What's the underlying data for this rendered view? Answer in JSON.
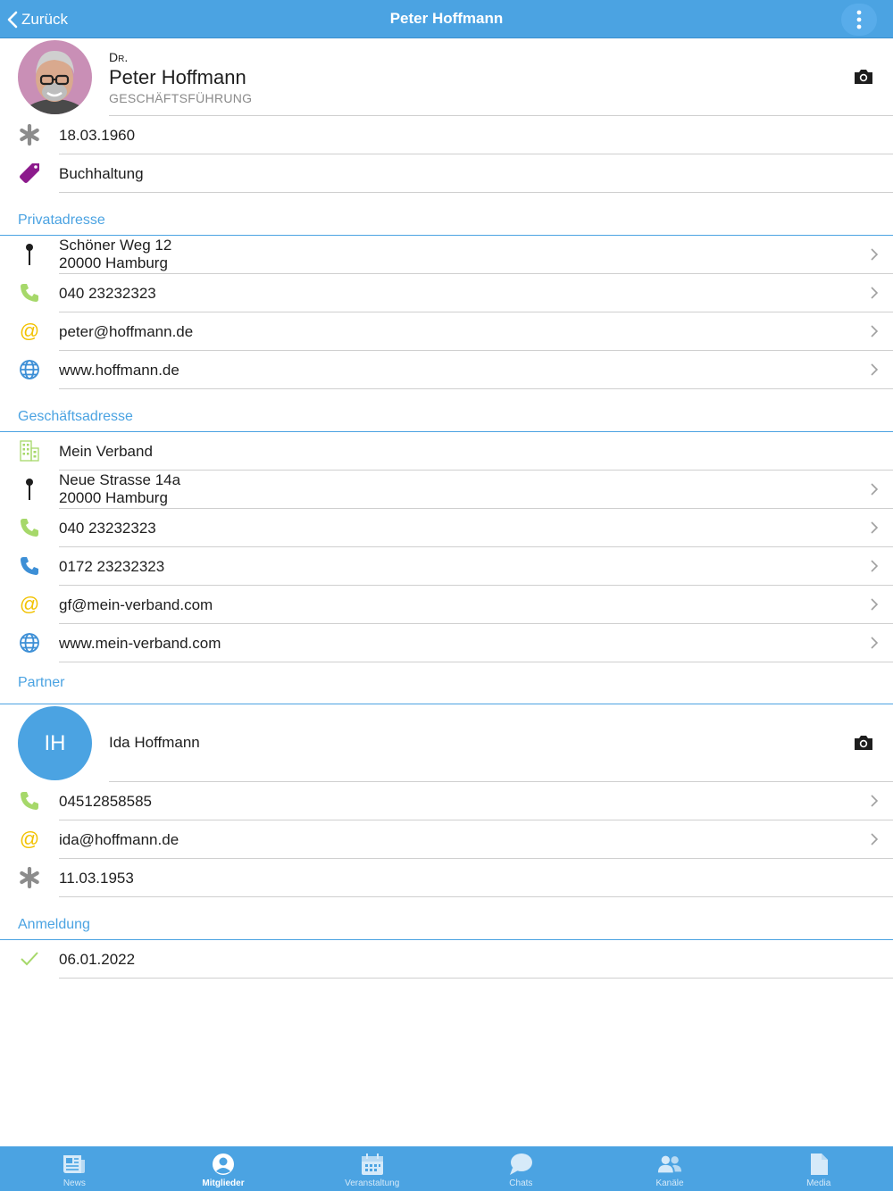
{
  "header": {
    "back_label": "Zurück",
    "title": "Peter Hoffmann"
  },
  "profile": {
    "salutation": "Dr.",
    "name": "Peter Hoffmann",
    "position": "Geschäftsführung",
    "birthday": "18.03.1960",
    "tag": "Buchhaltung"
  },
  "private": {
    "section_label": "Privatadresse",
    "street": "Schöner Weg 12",
    "city": "20000 Hamburg",
    "phone": "040 23232323",
    "email": "peter@hoffmann.de",
    "web": "www.hoffmann.de"
  },
  "business": {
    "section_label": "Geschäftsadresse",
    "company": "Mein Verband",
    "street": "Neue Strasse 14a",
    "city": "20000 Hamburg",
    "phone": "040 23232323",
    "mobile": "0172 23232323",
    "email": "gf@mein-verband.com",
    "web": "www.mein-verband.com"
  },
  "partner": {
    "section_label": "Partner",
    "initials": "IH",
    "name": "Ida Hoffmann",
    "phone": "04512858585",
    "email": "ida@hoffmann.de",
    "birthday": "11.03.1953"
  },
  "registration": {
    "section_label": "Anmeldung",
    "date": "06.01.2022"
  },
  "tabs": [
    {
      "label": "News",
      "icon": "news-icon"
    },
    {
      "label": "Mitglieder",
      "icon": "user-circle-icon"
    },
    {
      "label": "Veranstaltung",
      "icon": "calendar-icon"
    },
    {
      "label": "Chats",
      "icon": "chat-bubbles-icon"
    },
    {
      "label": "Kanäle",
      "icon": "group-icon"
    },
    {
      "label": "Media",
      "icon": "document-icon"
    }
  ],
  "active_tab": "Mitglieder",
  "colors": {
    "accent": "#4ba3e2",
    "phone_green": "#a6d86a",
    "phone_blue": "#3d8fd6",
    "email_yellow": "#f2c200",
    "tag_purple": "#8c1a8c",
    "check_green": "#a6d86a"
  }
}
